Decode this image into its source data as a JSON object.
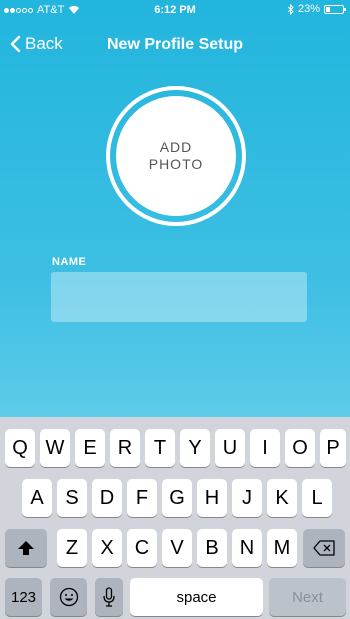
{
  "status_bar": {
    "carrier": "AT&T",
    "time": "6:12 PM",
    "battery": "23%",
    "battery_level": 0.23,
    "icons": {
      "wifi": "wifi-icon",
      "bluetooth": "bluetooth-icon",
      "battery": "battery-icon"
    }
  },
  "nav": {
    "back_label": "Back",
    "title": "New Profile Setup"
  },
  "photo": {
    "label_line1": "ADD",
    "label_line2": "PHOTO"
  },
  "form": {
    "name_label": "NAME",
    "name_value": ""
  },
  "keyboard": {
    "row1": [
      "Q",
      "W",
      "E",
      "R",
      "T",
      "Y",
      "U",
      "I",
      "O",
      "P"
    ],
    "row2": [
      "A",
      "S",
      "D",
      "F",
      "G",
      "H",
      "J",
      "K",
      "L"
    ],
    "row3": [
      "Z",
      "X",
      "C",
      "V",
      "B",
      "N",
      "M"
    ],
    "numbers_label": "123",
    "space_label": "space",
    "next_label": "Next",
    "icons": {
      "shift": "shift-icon",
      "delete": "delete-icon",
      "emoji": "emoji-icon",
      "mic": "microphone-icon"
    }
  },
  "colors": {
    "accent": "#22b5dd",
    "keyboard_bg": "#d1d5db"
  }
}
